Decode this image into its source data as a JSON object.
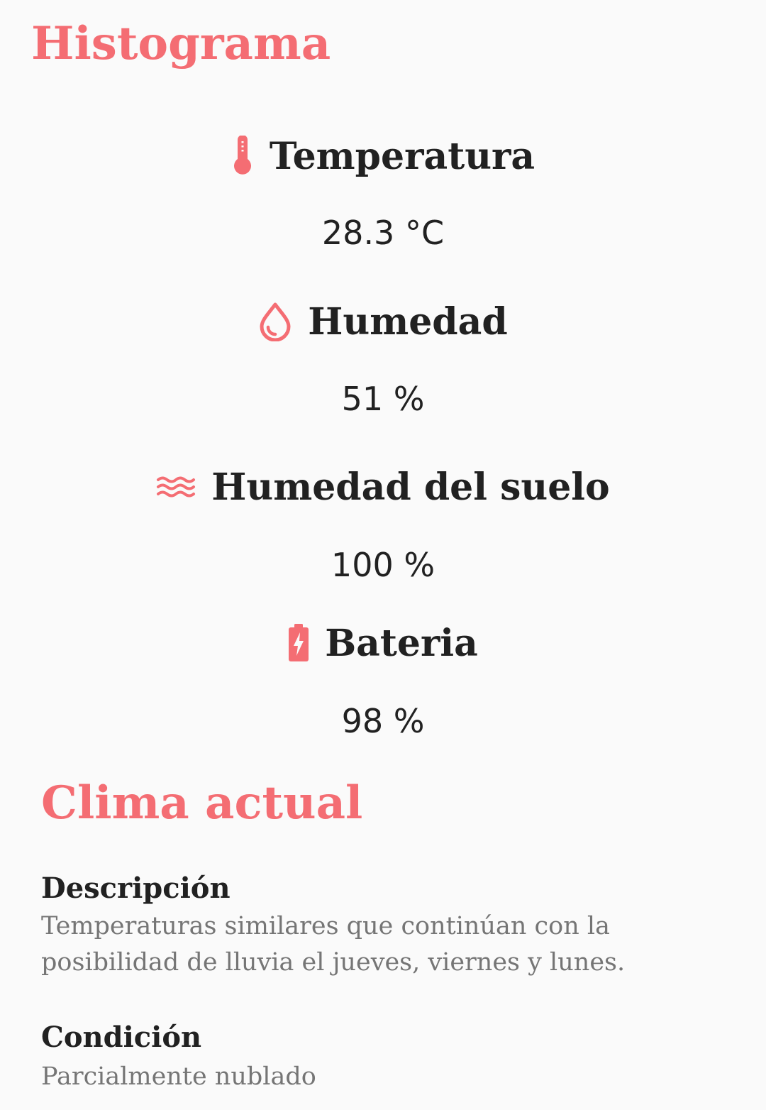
{
  "histogram": {
    "title": "Histograma",
    "metrics": [
      {
        "icon": "thermometer-icon",
        "label": "Temperatura",
        "value": "28.3 °C"
      },
      {
        "icon": "water-drop-icon",
        "label": "Humedad",
        "value": "51 %"
      },
      {
        "icon": "waves-icon",
        "label": "Humedad del suelo",
        "value": "100 %"
      },
      {
        "icon": "battery-charging-icon",
        "label": "Bateria",
        "value": "98 %"
      }
    ]
  },
  "weather": {
    "title": "Clima actual",
    "description_label": "Descripción",
    "description_text": "Temperaturas similares que continúan con la posibilidad de lluvia el jueves, viernes y lunes.",
    "condition_label": "Condición",
    "condition_text": "Parcialmente nublado"
  },
  "colors": {
    "accent": "#f46d73",
    "text": "#212121",
    "secondary_text": "#757575",
    "background": "#fafafa"
  }
}
